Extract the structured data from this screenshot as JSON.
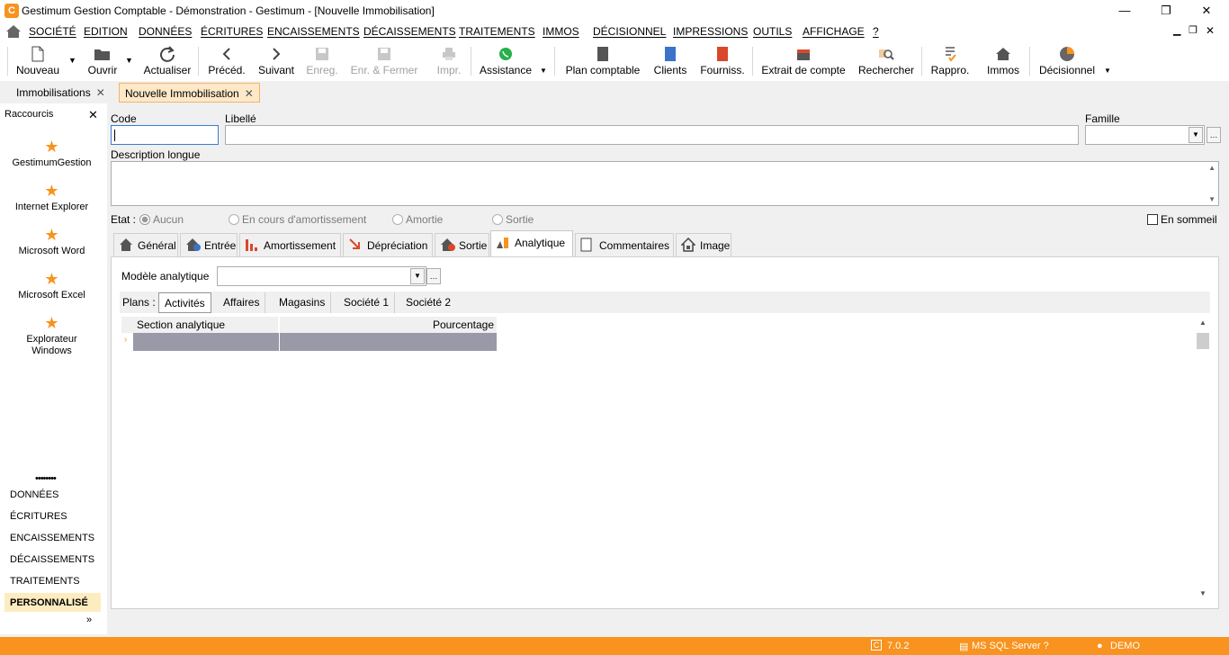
{
  "window": {
    "title": "Gestimum Gestion Comptable - Démonstration - Gestimum - [Nouvelle Immobilisation]",
    "app_icon": "C",
    "minimize": "—",
    "restore": "❐",
    "close": "✕"
  },
  "menu": [
    "SOCIÉTÉ",
    "EDITION",
    "DONNÉES",
    "ÉCRITURES",
    "ENCAISSEMENTS",
    "DÉCAISSEMENTS",
    "TRAITEMENTS",
    "IMMOS",
    "DÉCISIONNEL",
    "IMPRESSIONS",
    "OUTILS",
    "AFFICHAGE",
    "?"
  ],
  "toolbar": {
    "nouveau": "Nouveau",
    "ouvrir": "Ouvrir",
    "actualiser": "Actualiser",
    "preced": "Précéd.",
    "suivant": "Suivant",
    "enreg": "Enreg.",
    "enr_fermer": "Enr. & Fermer",
    "impr": "Impr.",
    "assistance": "Assistance",
    "plan_comptable": "Plan comptable",
    "clients": "Clients",
    "fourniss": "Fourniss.",
    "extrait": "Extrait de compte",
    "rechercher": "Rechercher",
    "rappro": "Rappro.",
    "immos": "Immos",
    "decisionnel": "Décisionnel"
  },
  "doc_tabs": [
    {
      "label": "Immobilisations"
    },
    {
      "label": "Nouvelle Immobilisation"
    }
  ],
  "sidebar": {
    "header": "Raccourcis",
    "shortcuts": [
      "GestimumGestion",
      "Internet Explorer",
      "Microsoft Word",
      "Microsoft Excel",
      "Explorateur Windows"
    ],
    "dots": "••••••••",
    "nav": [
      "DONNÉES",
      "ÉCRITURES",
      "ENCAISSEMENTS",
      "DÉCAISSEMENTS",
      "TRAITEMENTS",
      "PERSONNALISÉ"
    ],
    "active_nav": "PERSONNALISÉ"
  },
  "form": {
    "code_label": "Code",
    "code_value": "",
    "libelle_label": "Libellé",
    "libelle_value": "",
    "famille_label": "Famille",
    "famille_value": "",
    "description_label": "Description longue",
    "description_value": "",
    "etat_label": "Etat :",
    "etat_options": [
      "Aucun",
      "En cours d'amortissement",
      "Amortie",
      "Sortie"
    ],
    "etat_selected": "Aucun",
    "en_sommeil": "En sommeil"
  },
  "tabs": [
    "Général",
    "Entrée",
    "Amortissement",
    "Dépréciation",
    "Sortie",
    "Analytique",
    "Commentaires",
    "Image"
  ],
  "active_tab": "Analytique",
  "analytique": {
    "modele_label": "Modèle analytique",
    "modele_value": "",
    "plans_label": "Plans :",
    "plans": [
      "Activités",
      "Affaires",
      "Magasins",
      "Société 1",
      "Société 2"
    ],
    "active_plan": "Activités",
    "columns": [
      "Section analytique",
      "Pourcentage"
    ]
  },
  "status": {
    "version": "7.0.2",
    "server": "MS SQL Server ?",
    "user": "DEMO"
  },
  "colors": {
    "accent": "#f7931e",
    "tab_active_bg": "#fde8c8",
    "grid_row": "#9999a8"
  }
}
